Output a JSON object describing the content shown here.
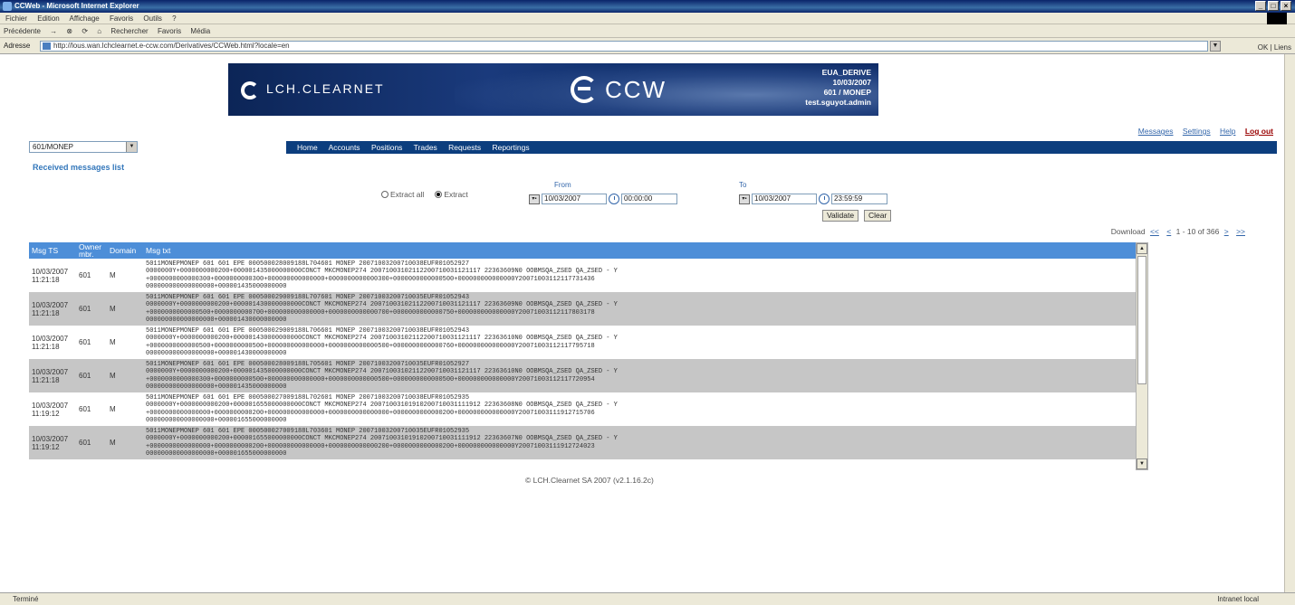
{
  "window": {
    "title": "CCWeb - Microsoft Internet Explorer"
  },
  "menu": [
    "Fichier",
    "Edition",
    "Affichage",
    "Favoris",
    "Outils",
    "?"
  ],
  "toolbar": [
    "Précédente",
    "Rechercher",
    "Favoris",
    "Média"
  ],
  "address": {
    "label": "Adresse",
    "url": "http://lous.wan.lchclearnet.e-ccw.com/Derivatives/CCWeb.html?locale=en",
    "go_label": "OK",
    "links_label": "Liens"
  },
  "banner": {
    "brand_left": "LCH.CLEARNET",
    "brand_right": "CCW",
    "info": [
      "EUA_DERIVE",
      "10/03/2007",
      "601 / MONEP",
      "test.sguyot.admin"
    ]
  },
  "toplinks": [
    "Messages",
    "Settings",
    "Help",
    "Log out"
  ],
  "account_select": "601/MONEP",
  "nav": [
    "Home",
    "Accounts",
    "Positions",
    "Trades",
    "Requests",
    "Reportings"
  ],
  "heading": "Received messages list",
  "filter": {
    "extract_all": "Extract all",
    "extract": "Extract",
    "from_label": "From",
    "to_label": "To",
    "from_date": "10/03/2007",
    "from_time": "00:00:00",
    "to_date": "10/03/2007",
    "to_time": "23:59:59"
  },
  "buttons": {
    "validate": "Validate",
    "clear": "Clear"
  },
  "pager": {
    "download": "Download",
    "first": "<<",
    "prev": "<",
    "range": "1 - 10 of 366",
    "next": ">",
    "last": ">>"
  },
  "table": {
    "headers": [
      "Msg TS",
      "Owner mbr.",
      "Domain",
      "Msg txt"
    ],
    "rows": [
      {
        "ts": "10/03/2007 11:21:18",
        "owner": "601",
        "domain": "M",
        "msg": "5011MONEPMONEP 601 601 EPE 000500028009188L704601 MONEP 20071003200710038EUFR01052927\n0000000Y+0000000000200+000001435000000000CONCT MKCMONEP274 20071003102112200710031121117 22363609N0 OOBMSQA_ZSED QA_ZSED - Y\n+0000000000000300+0000000000300+000000000000000+0000000000000300+0000000000000500+000000000000000Y20071003112117731436\n000000000000000000+000001435000000000"
      },
      {
        "ts": "10/03/2007 11:21:18",
        "owner": "601",
        "domain": "M",
        "msg": "5011MONEPMONEP 601 601 EPE 000500029009188L707601 MONEP 20071003200710035EUFR01052943\n0000000Y+0000000000200+000001430000000000CONCT MKCMONEP274 20071003102112200710031121117 22363609N0 OOBMSQA_ZSED QA_ZSED - Y\n+0000000000000500+0000000000700+000000000000000+0000000000000700+0000000000000750+000000000000000Y20071003112117803178\n000000000000000000+000001430000000000"
      },
      {
        "ts": "10/03/2007 11:21:18",
        "owner": "601",
        "domain": "M",
        "msg": "5011MONEPMONEP 601 601 EPE 000500029009188L706601 MONEP 20071003200710038EUFR01052943\n0000000Y+0000000000200+000001430000000000CONCT MKCMONEP274 20071003102112200710031121117 22363610N0 OOBMSQA_ZSED QA_ZSED - Y\n+0000000000000500+0000000000500+000000000000000+0000000000000500+0000000000000760+000000000000000Y20071003112117795718\n000000000000000000+000001430000000000"
      },
      {
        "ts": "10/03/2007 11:21:18",
        "owner": "601",
        "domain": "M",
        "msg": "5011MONEPMONEP 601 601 EPE 000500028009188L705601 MONEP 20071003200710035EUFR01052927\n0000000Y+0000000000200+000001435000000000CONCT MKCMONEP274 20071003102112200710031121117 22363610N0 OOBMSQA_ZSED QA_ZSED - Y\n+0000000000000300+0000000000500+000000000000000+0000000000000500+0000000000000500+000000000000000Y20071003112117720954\n000000000000000000+000001435000000000"
      },
      {
        "ts": "10/03/2007 11:19:12",
        "owner": "601",
        "domain": "M",
        "msg": "5011MONEPMONEP 601 601 EPE 000500027009188L702601 MONEP 20071003200710038EUFR01052935\n0000000Y+0000000000200+000001655000000000CONCT MKCMONEP274 20071003101910200710031111912 22363608N0 OOBMSQA_ZSED QA_ZSED - Y\n+0000000000000000+0000000000200+000000000000000+0000000000000000+0000000000000200+000000000000000Y20071003111912715706\n000000000000000000+000001655000000000"
      },
      {
        "ts": "10/03/2007 11:19:12",
        "owner": "601",
        "domain": "M",
        "msg": "5011MONEPMONEP 601 601 EPE 000500027009188L703601 MONEP 20071003200710035EUFR01052935\n0000000Y+0000000000200+000001655000000000CONCT MKCMONEP274 20071003101910200710031111912 22363607N0 OOBMSQA_ZSED QA_ZSED - Y\n+0000000000000000+0000000000200+000000000000000+0000000000000200+0000000000000200+000000000000000Y20071003111912724023\n000000000000000000+000001655000000000"
      }
    ]
  },
  "copyright": "© LCH.Clearnet SA 2007 (v2.1.16.2c)",
  "status": {
    "left": "Terminé",
    "zone": "Intranet local"
  }
}
